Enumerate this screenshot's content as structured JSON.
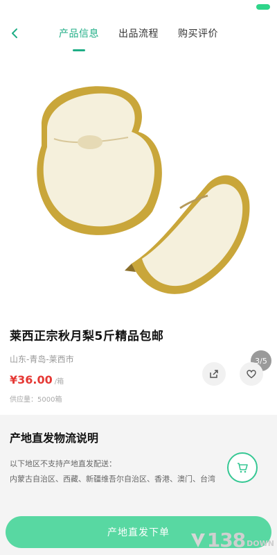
{
  "nav": {
    "tabs": [
      {
        "label": "产品信息",
        "active": true
      },
      {
        "label": "出品流程",
        "active": false
      },
      {
        "label": "购买评价",
        "active": false
      }
    ]
  },
  "gallery": {
    "indicator": "3/5"
  },
  "product": {
    "title": "莱西正宗秋月梨5斤精品包邮",
    "origin": "山东-青岛-莱西市",
    "price": "¥36.00",
    "unit": "/箱",
    "supply": "供应量：5000箱"
  },
  "logistics": {
    "title": "产地直发物流说明",
    "subtitle": "以下地区不支持产地直发配送：",
    "regions": "内蒙古自治区、西藏、新疆维吾尔自治区、香港、澳门、台湾"
  },
  "actions": {
    "order_label": "产地直发下单"
  },
  "watermark": {
    "number": "138",
    "suffix": "DOWN"
  },
  "colors": {
    "accent": "#1fae86",
    "price": "#e53935",
    "button": "#58d8a2"
  },
  "icons": {
    "back": "chevron-left-icon",
    "share": "share-icon",
    "favorite": "heart-icon",
    "cart": "cart-icon"
  }
}
